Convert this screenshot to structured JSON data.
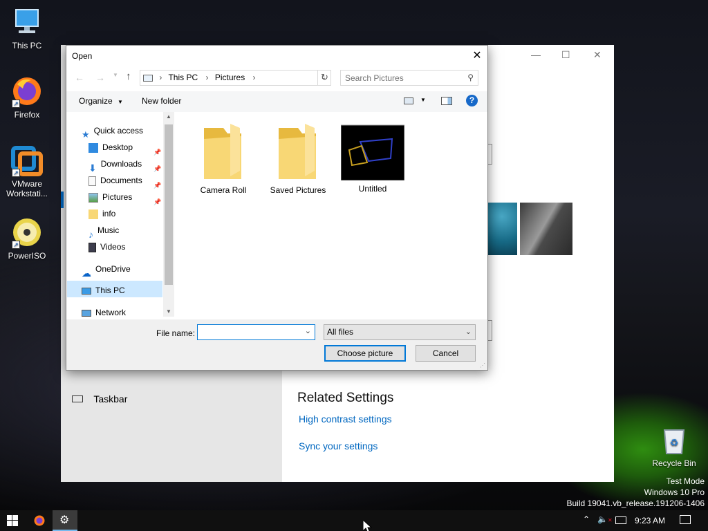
{
  "desktop": {
    "icons": [
      {
        "label": "This PC"
      },
      {
        "label": "Firefox"
      },
      {
        "label": "VMware Workstati..."
      },
      {
        "label": "PowerISO"
      },
      {
        "label": "Recycle Bin"
      }
    ],
    "watermark": [
      "Test Mode",
      "Windows 10 Pro",
      "Build 19041.vb_release.191206-1406"
    ]
  },
  "settings": {
    "related_title": "Related Settings",
    "links": [
      "High contrast settings",
      "Sync your settings"
    ],
    "nav_taskbar": "Taskbar"
  },
  "dialog": {
    "title": "Open",
    "breadcrumb": [
      "This PC",
      "Pictures"
    ],
    "search_placeholder": "Search Pictures",
    "toolbar": {
      "organize": "Organize",
      "new_folder": "New folder"
    },
    "nav": [
      {
        "label": "Quick access"
      },
      {
        "label": "Desktop"
      },
      {
        "label": "Downloads"
      },
      {
        "label": "Documents"
      },
      {
        "label": "Pictures"
      },
      {
        "label": "info"
      },
      {
        "label": "Music"
      },
      {
        "label": "Videos"
      },
      {
        "label": "OneDrive"
      },
      {
        "label": "This PC"
      },
      {
        "label": "Network"
      }
    ],
    "files": [
      {
        "name": "Camera Roll",
        "type": "folder"
      },
      {
        "name": "Saved Pictures",
        "type": "folder"
      },
      {
        "name": "Untitled",
        "type": "image"
      }
    ],
    "filename_label": "File name:",
    "filename_value": "",
    "filetype_value": "All files",
    "choose_button": "Choose picture",
    "cancel_button": "Cancel"
  },
  "taskbar": {
    "time": "9:23 AM"
  },
  "colors": {
    "accent": "#0067c0",
    "link": "#0067c0",
    "selection": "#cce8ff",
    "folder": "#f8d775"
  }
}
